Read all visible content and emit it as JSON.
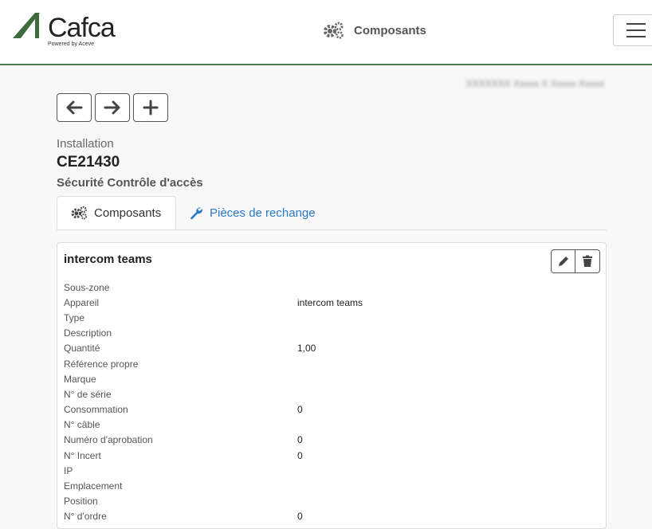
{
  "brand": {
    "name": "Cafca",
    "tagline": "Powered by Aceve",
    "accent_color": "#4b7a4b"
  },
  "header": {
    "title": "Composants",
    "title_icon": "gears-icon",
    "menu_icon": "hamburger-icon"
  },
  "user_info": "XXXXXXX Xxxxx X Xxxxx Xxxxx",
  "nav": {
    "back_icon": "arrow-left-icon",
    "forward_icon": "arrow-right-icon",
    "add_icon": "plus-icon"
  },
  "installation": {
    "label": "Installation",
    "code": "CE21430",
    "category": "Sécurité Contrôle d'accès"
  },
  "tabs": [
    {
      "label": "Composants",
      "icon": "gears-icon",
      "active": true
    },
    {
      "label": "Pièces de rechange",
      "icon": "wrench-icon",
      "active": false
    }
  ],
  "component": {
    "title": "intercom teams",
    "edit_icon": "pencil-icon",
    "delete_icon": "trash-icon",
    "properties": [
      {
        "label": "Sous-zone",
        "value": ""
      },
      {
        "label": "Appareil",
        "value": "intercom teams"
      },
      {
        "label": "Type",
        "value": ""
      },
      {
        "label": "Description",
        "value": ""
      },
      {
        "label": "Quantité",
        "value": "1,00"
      },
      {
        "label": "Référence propre",
        "value": ""
      },
      {
        "label": "Marque",
        "value": ""
      },
      {
        "label": "N° de série",
        "value": ""
      },
      {
        "label": "Consommation",
        "value": "0"
      },
      {
        "label": "N° câble",
        "value": ""
      },
      {
        "label": "Numéro d'aprobation",
        "value": "0"
      },
      {
        "label": "N° Incert",
        "value": "0"
      },
      {
        "label": "IP",
        "value": ""
      },
      {
        "label": "Emplacement",
        "value": ""
      },
      {
        "label": "Position",
        "value": ""
      },
      {
        "label": "N° d'ordre",
        "value": "0"
      }
    ]
  }
}
